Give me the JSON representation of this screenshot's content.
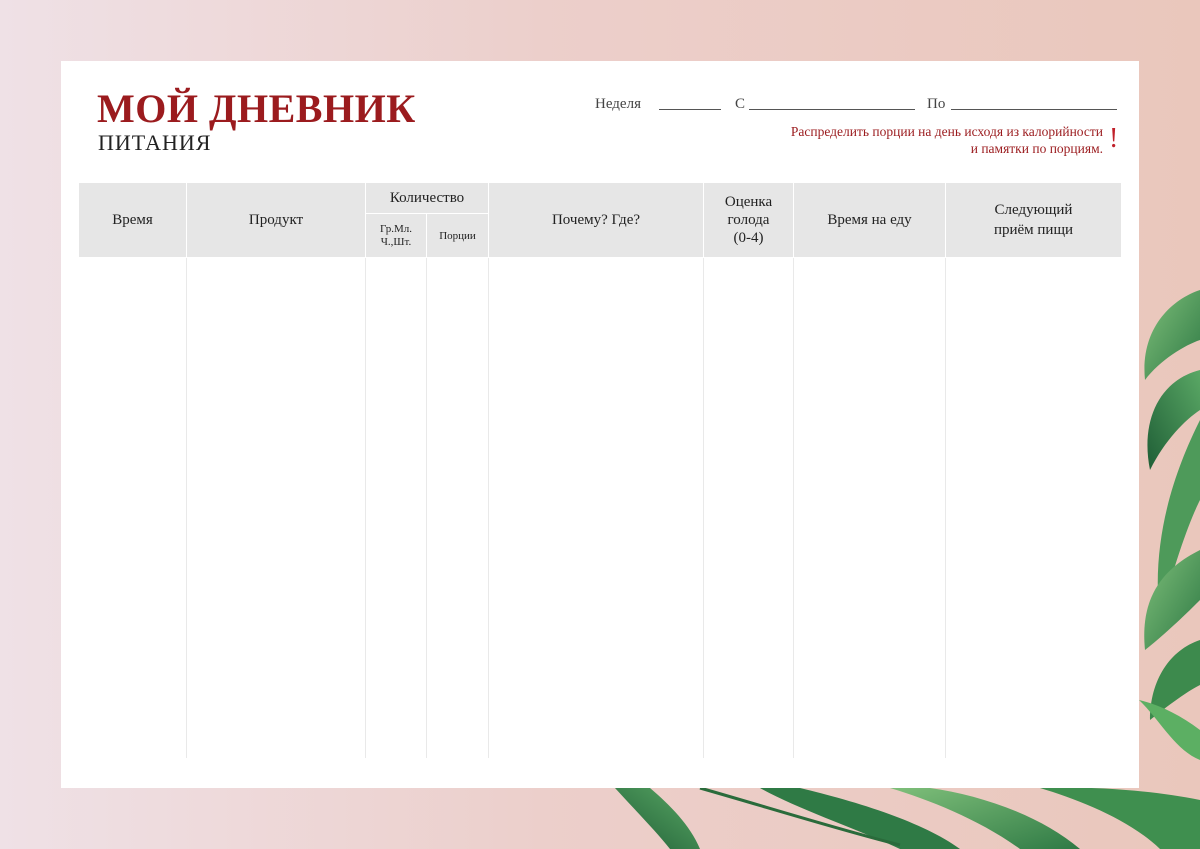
{
  "header": {
    "title": "МОЙ ДНЕВНИК",
    "subtitle": "ПИТАНИЯ",
    "week_label": "Неделя",
    "from_label": "С",
    "to_label": "По",
    "note_line1": "Распределить порции на день исходя из калорийности",
    "note_line2": "и памятки по порциям.",
    "note_mark": "!"
  },
  "table": {
    "col_time": "Время",
    "col_product": "Продукт",
    "col_quantity": "Количество",
    "col_units_line1": "Гр.Мл.",
    "col_units_line2": "Ч.,Шт.",
    "col_portions": "Порции",
    "col_why": "Почему? Где?",
    "col_hunger_line1": "Оценка",
    "col_hunger_line2": "голода",
    "col_hunger_line3": "(0-4)",
    "col_eat_time": "Время на еду",
    "col_next_line1": "Следующий",
    "col_next_line2": "приём пищи"
  },
  "colors": {
    "accent": "#9b1b1e",
    "header_bg": "#e6e6e6",
    "background": "#eccfcb"
  }
}
